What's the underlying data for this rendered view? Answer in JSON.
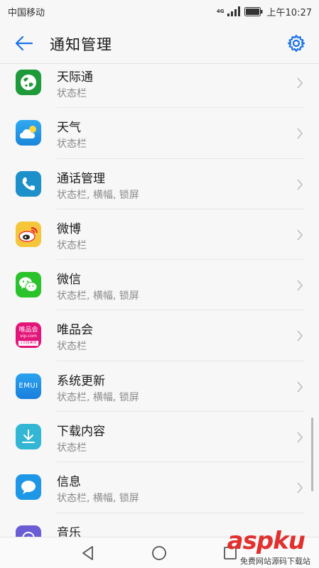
{
  "status_bar": {
    "carrier": "中国移动",
    "network": "4G",
    "time": "上午10:27"
  },
  "header": {
    "title": "通知管理"
  },
  "apps": [
    {
      "name": "天际通",
      "sub": "状态栏",
      "icon": "globe-icon",
      "color": "#1f9a3a"
    },
    {
      "name": "天气",
      "sub": "状态栏",
      "icon": "weather-icon",
      "color": "#2c9be8"
    },
    {
      "name": "通话管理",
      "sub": "状态栏, 横幅, 锁屏",
      "icon": "phone-icon",
      "color": "#1d8fc9"
    },
    {
      "name": "微博",
      "sub": "状态栏",
      "icon": "weibo-icon",
      "color": "#f5c63a"
    },
    {
      "name": "微信",
      "sub": "状态栏, 横幅, 锁屏",
      "icon": "wechat-icon",
      "color": "#2bc32b"
    },
    {
      "name": "唯品会",
      "sub": "状态栏",
      "icon": "vip-icon",
      "color": "#e3157a"
    },
    {
      "name": "系统更新",
      "sub": "状态栏, 横幅, 锁屏",
      "icon": "emui-icon",
      "color": "#1f8fe0"
    },
    {
      "name": "下载内容",
      "sub": "状态栏",
      "icon": "download-icon",
      "color": "#33b6d4"
    },
    {
      "name": "信息",
      "sub": "状态栏, 横幅, 锁屏",
      "icon": "message-icon",
      "color": "#1e97e6"
    },
    {
      "name": "音乐",
      "sub": "",
      "icon": "music-icon",
      "color": "#6a5cd4"
    }
  ],
  "icon_labels": {
    "vip_line1": "唯品会",
    "vip_line2": "vip.com",
    "vip_line3": "1元抢美妆",
    "emui": "EMUI"
  },
  "colors": {
    "accent": "#1a73e8"
  },
  "watermark": {
    "text": "aspku",
    "sub": "免费网站源码下载站"
  }
}
